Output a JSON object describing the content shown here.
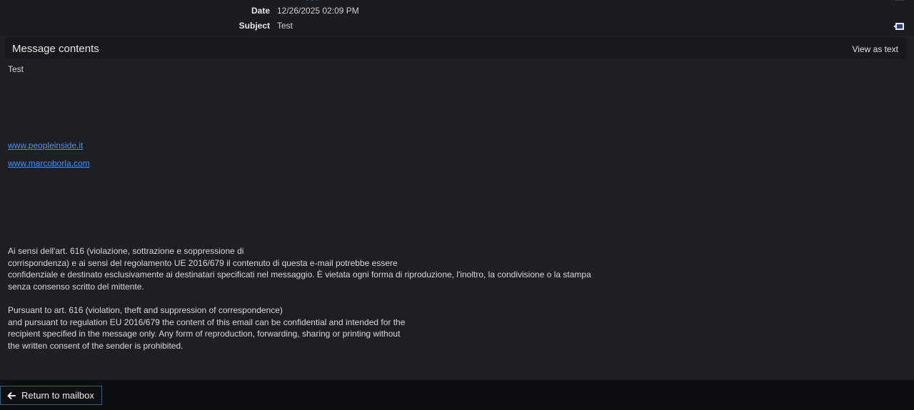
{
  "header": {
    "date_label": "Date",
    "date_value": "12/26/2025 02:09 PM",
    "subject_label": "Subject",
    "subject_value": "Test"
  },
  "message": {
    "section_title": "Message contents",
    "view_as_text": "View as text",
    "greeting": "Test",
    "links": [
      "www.peopleinside.it",
      "www.marcoborla.com"
    ],
    "disclaimer_it": [
      "Ai sensi dell'art. 616 (violazione, sottrazione e soppressione di",
      "corrispondenza) e ai sensi del regolamento UE 2016/679 il contenuto di questa e-mail potrebbe essere",
      "confidenziale e destinato esclusivamente ai destinatari specificati nel messaggio. È vietata ogni forma di riproduzione, l'inoltro, la condivisione o la stampa",
      "senza consenso scritto del mittente."
    ],
    "disclaimer_en": [
      "Pursuant to art. 616 (violation, theft and suppression of correspondence)",
      "and pursuant to regulation EU 2016/679 the content of this email can be confidential and intended for the",
      "recipient specified in the message only. Any form of reproduction, forwarding, sharing or printing without",
      "the written consent of the sender is prohibited."
    ]
  },
  "footer": {
    "return_label": "Return to mailbox"
  },
  "icons": {
    "return": "arrow-left-icon",
    "message_action": "message-popout-icon"
  },
  "colors": {
    "background": "#1e1f22",
    "link": "#4a90f0",
    "button_border": "#2d5f8f"
  }
}
